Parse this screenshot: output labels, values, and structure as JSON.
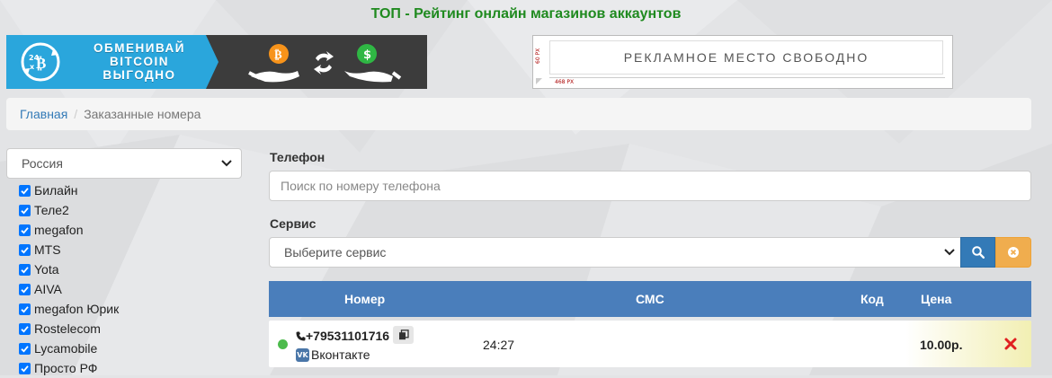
{
  "header": {
    "title": "ТОП - Рейтинг онлайн магазинов аккаунтов"
  },
  "banners": {
    "bitcoin": {
      "logo_text": "24",
      "lines": [
        "ОБМЕНИВАЙ",
        "BITCOIN",
        "ВЫГОДНО"
      ],
      "accent": "#2aa6dc"
    },
    "ad": {
      "text": "РЕКЛАМНОЕ МЕСТО СВОБОДНО",
      "size_v": "60 PX",
      "size_h": "468 PX"
    }
  },
  "breadcrumb": {
    "home": "Главная",
    "separator": "/",
    "current": "Заказанные номера"
  },
  "sidebar": {
    "country": "Россия",
    "operators": [
      {
        "label": "Билайн",
        "checked": true
      },
      {
        "label": "Теле2",
        "checked": true
      },
      {
        "label": "megafon",
        "checked": true
      },
      {
        "label": "MTS",
        "checked": true
      },
      {
        "label": "Yota",
        "checked": true
      },
      {
        "label": "AIVA",
        "checked": true
      },
      {
        "label": "megafon Юрик",
        "checked": true
      },
      {
        "label": "Rostelecom",
        "checked": true
      },
      {
        "label": "Lycamobile",
        "checked": true
      },
      {
        "label": "Просто РФ",
        "checked": true
      }
    ]
  },
  "filters": {
    "phone_label": "Телефон",
    "phone_placeholder": "Поиск по номеру телефона",
    "service_label": "Сервис",
    "service_selected": "Выберите сервис"
  },
  "table": {
    "headers": {
      "number": "Номер",
      "sms": "СМС",
      "code": "Код",
      "price": "Цена"
    },
    "rows": [
      {
        "status": "active",
        "phone": "+79531101716",
        "service": "Вконтакте",
        "sms": "24:27",
        "code": "",
        "price": "10.00р."
      }
    ]
  },
  "colors": {
    "primary": "#337ab7",
    "table_header": "#4a7ebb",
    "warning": "#f0ad4e",
    "title_green": "#1f8a1f",
    "status_active": "#4cbb4c",
    "delete_red": "#e02020"
  }
}
